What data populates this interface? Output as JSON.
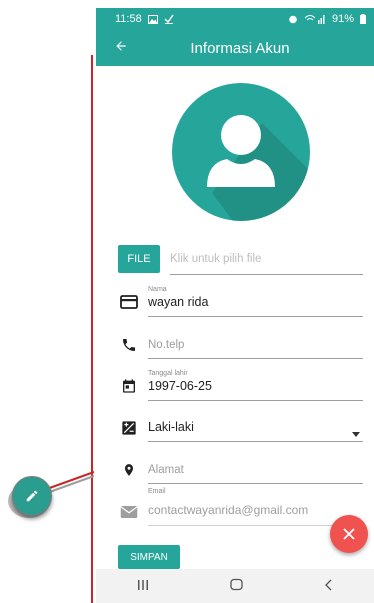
{
  "status_bar": {
    "time": "11:58",
    "battery": "91%"
  },
  "app_bar": {
    "title": "Informasi Akun"
  },
  "form": {
    "file_button": "FILE",
    "file_placeholder": "Klik untuk pilih file",
    "name_label": "Nama",
    "name_value": "wayan rida",
    "phone_placeholder": "No.telp",
    "birth_label": "Tanggal lahir",
    "birth_value": "1997-06-25",
    "gender_value": "Laki-laki",
    "address_placeholder": "Alamat",
    "email_label": "Email",
    "email_value": "contactwayanrida@gmail.com",
    "save_button": "SIMPAN"
  },
  "colors": {
    "primary": "#26a69a",
    "fab_close": "#f0524f",
    "annotation": "#c62828"
  },
  "icons": {
    "back": "arrow-left-icon",
    "card": "credit-card-icon",
    "phone": "phone-icon",
    "calendar": "calendar-icon",
    "gender": "gender-icon",
    "location": "location-pin-icon",
    "email": "envelope-icon",
    "close": "close-icon",
    "edit": "pencil-icon"
  }
}
